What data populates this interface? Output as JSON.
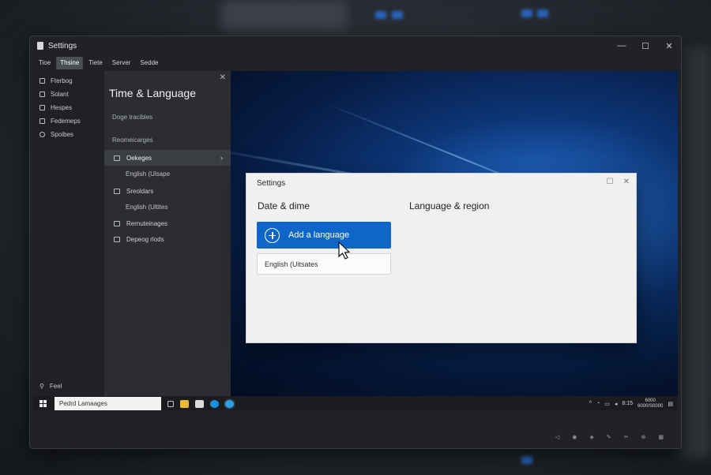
{
  "window": {
    "title": "Settings",
    "controls": [
      "—",
      "☐",
      "✕"
    ]
  },
  "menubar": [
    "Tioe",
    "Thsine",
    "Tiete",
    "Server",
    "Sedde"
  ],
  "leftnav": {
    "items": [
      "Fterbog",
      "Solant",
      "Hespes",
      "Fedemeps",
      "Spoibes"
    ],
    "footer": "Feel"
  },
  "panel": {
    "title": "Time & Language",
    "sub1": "Doge tracibles",
    "sub2": "Reomeicarges",
    "rows": [
      {
        "label": "Oekeges",
        "selected": true
      },
      {
        "label": "English (Ulsape",
        "indent": true
      },
      {
        "label": "Sreoldars"
      },
      {
        "label": "English (Ultites",
        "indent": true
      },
      {
        "label": "Rernuteinages"
      },
      {
        "label": "Depeog rlods"
      }
    ]
  },
  "dialog": {
    "title": "Settings",
    "left_heading": "Date & dime",
    "right_heading": "Language & region",
    "add_button": "Add a language",
    "language_item": "English (Uitsates"
  },
  "taskbar": {
    "search_text": "Pedrd Lamaages",
    "clock_time": "8:15",
    "clock_line1": "6000",
    "clock_line2": "6000/S0000"
  },
  "colors": {
    "accent": "#0f66c9",
    "window_bg": "#202226",
    "panel_bg": "#2b2d31"
  }
}
